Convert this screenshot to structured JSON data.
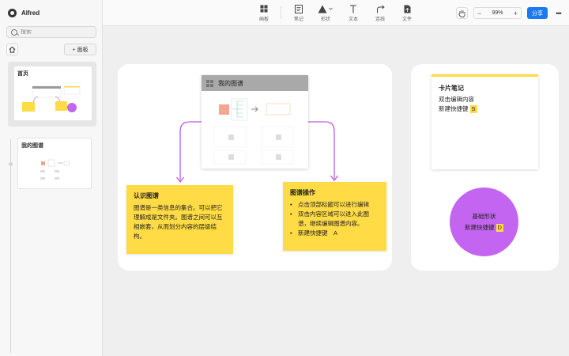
{
  "app": {
    "name": "Alfred"
  },
  "sidebar": {
    "search_placeholder": "搜索",
    "add_board_label": "+ 面板",
    "pages": [
      {
        "title": "首页"
      },
      {
        "title": "我的图谱"
      }
    ]
  },
  "toolbar": {
    "tools": [
      {
        "label": "画板",
        "icon": "board-grid-icon"
      },
      {
        "label": "笔记",
        "icon": "note-icon"
      },
      {
        "label": "形状",
        "icon": "shape-triangle-icon"
      },
      {
        "label": "文本",
        "icon": "text-icon"
      },
      {
        "label": "连线",
        "icon": "connector-icon"
      },
      {
        "label": "文件",
        "icon": "file-icon"
      }
    ],
    "zoom_minus": "−",
    "zoom_value": "99%",
    "zoom_plus": "+",
    "share_label": "分享",
    "more_label": "•••"
  },
  "canvas": {
    "map_card": {
      "title": "我的图谱"
    },
    "sticky_1": {
      "title": "认识图谱",
      "body": "图谱是一类信息的集合。可以把它理解成是文件夹。图谱之间可以互相嵌套，从而划分内容的层级结构。"
    },
    "sticky_2": {
      "title": "图谱操作",
      "items": [
        "点击顶部标题可以进行编辑",
        "双击内容区域可以进入此图谱，继续编辑图谱内容。",
        "新建快捷键　A"
      ]
    },
    "note_card": {
      "title": "卡片笔记",
      "line1": "双击编辑内容",
      "line2": "新建快捷键",
      "shortcut": "S"
    },
    "shape": {
      "title": "基础形状",
      "line": "新建快捷键",
      "shortcut": "D"
    }
  },
  "colors": {
    "sticky": "#ffdb45",
    "accent": "#1c79f2",
    "shape": "#c365f0",
    "connector": "#b85ce6"
  }
}
